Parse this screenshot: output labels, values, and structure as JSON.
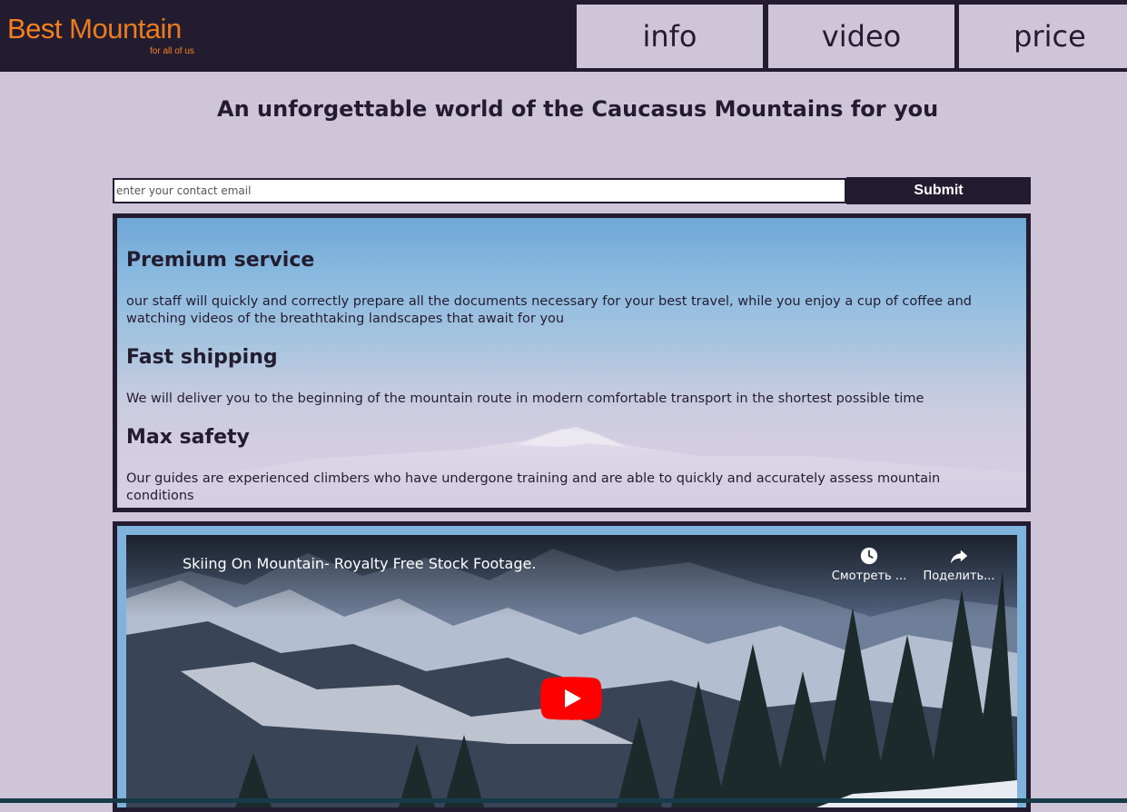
{
  "brand": {
    "name_part1": "Best",
    "name_part2": "Mountain",
    "tagline": "for all of us",
    "accent_color": "#f5811f",
    "dark_color": "#231c30",
    "light_color": "#cec5d9"
  },
  "nav": {
    "info": "info",
    "video": "video",
    "price": "price"
  },
  "headline": "An unforgettable world of the Caucasus Mountains for you",
  "form": {
    "email_placeholder": "enter your contact email",
    "email_value": "",
    "submit_label": "Submit"
  },
  "features": [
    {
      "title": "Premium service",
      "text": "our staff will quickly and correctly prepare all the documents necessary for your best travel, while you enjoy a cup of coffee and watching videos of the breathtaking landscapes that await for you"
    },
    {
      "title": "Fast shipping",
      "text": "We will deliver you to the beginning of the mountain route in modern comfortable transport in the shortest possible time"
    },
    {
      "title": "Max safety",
      "text": "Our guides are experienced climbers who have undergone training and are able to quickly and accurately assess mountain conditions"
    }
  ],
  "video": {
    "title": "Skiing On Mountain- Royalty Free Stock Footage.",
    "watch_later_label": "Смотреть ...",
    "share_label": "Поделить...",
    "icons": [
      "clock-icon",
      "share-icon",
      "play-icon"
    ]
  }
}
